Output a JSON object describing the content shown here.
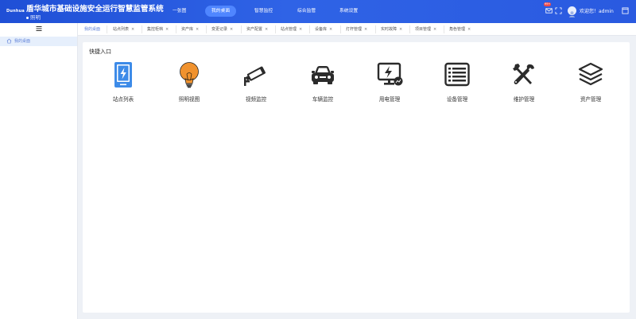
{
  "header": {
    "logo_text": "Dunhua",
    "title": "盾华城市基础设施安全运行智慧监管系统",
    "subtitle": "照明",
    "nav": [
      {
        "label": "一张图",
        "active": false
      },
      {
        "label": "我的桌面",
        "active": true
      },
      {
        "label": "智慧监控",
        "active": false
      },
      {
        "label": "综合监管",
        "active": false
      },
      {
        "label": "系统设置",
        "active": false
      }
    ],
    "notification_badge": "99+",
    "welcome": "欢迎您！admin"
  },
  "sidebar": {
    "items": [
      {
        "label": "我的桌面",
        "icon": "home-icon"
      }
    ]
  },
  "tabs": [
    {
      "label": "我的桌面",
      "active": true,
      "closable": false
    },
    {
      "label": "站点列表",
      "active": false,
      "closable": true
    },
    {
      "label": "集控柜档",
      "active": false,
      "closable": true
    },
    {
      "label": "资产库",
      "active": false,
      "closable": true
    },
    {
      "label": "变更记录",
      "active": false,
      "closable": true
    },
    {
      "label": "资产配置",
      "active": false,
      "closable": true
    },
    {
      "label": "站点管理",
      "active": false,
      "closable": true
    },
    {
      "label": "设备库",
      "active": false,
      "closable": true
    },
    {
      "label": "灯杆管理",
      "active": false,
      "closable": true
    },
    {
      "label": "实时故障",
      "active": false,
      "closable": true
    },
    {
      "label": "项目管理",
      "active": false,
      "closable": true
    },
    {
      "label": "角色管理",
      "active": false,
      "closable": true
    }
  ],
  "panel": {
    "title": "快捷入口",
    "quick_links": [
      {
        "label": "站点列表",
        "icon": "station-list-icon"
      },
      {
        "label": "照明视图",
        "icon": "lightbulb-icon"
      },
      {
        "label": "视频监控",
        "icon": "camera-icon"
      },
      {
        "label": "车辆监控",
        "icon": "car-icon"
      },
      {
        "label": "用电管理",
        "icon": "power-monitor-icon"
      },
      {
        "label": "设备管理",
        "icon": "server-icon"
      },
      {
        "label": "维护管理",
        "icon": "tools-icon"
      },
      {
        "label": "资产管理",
        "icon": "layers-icon"
      }
    ]
  },
  "colors": {
    "header_blue": "#2a5ae0",
    "active_nav": "#4f86ff",
    "accent_text": "#5d7fd7",
    "station_icon": "#3d8be8",
    "bulb_icon": "#f0922e"
  }
}
